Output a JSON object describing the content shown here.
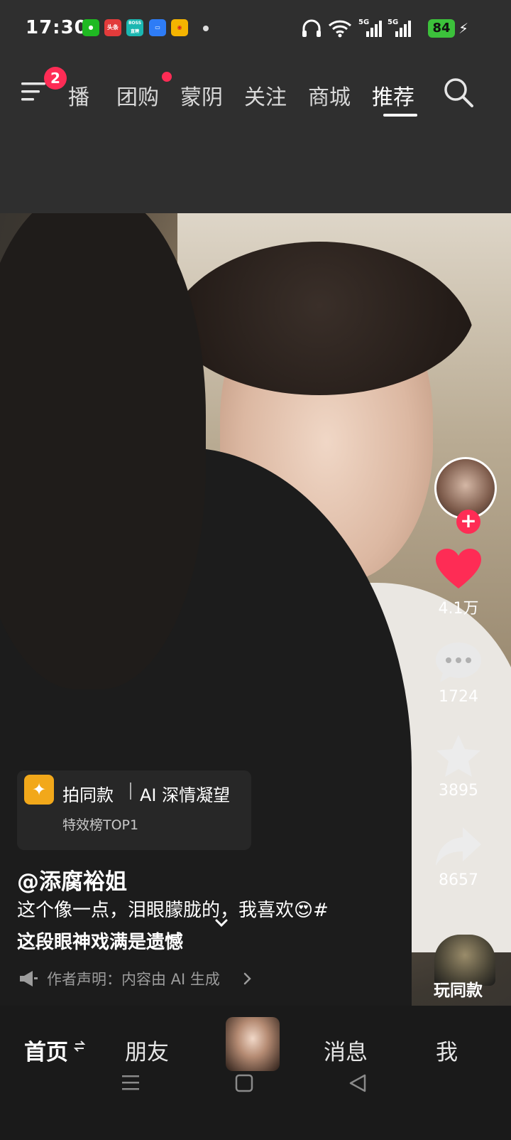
{
  "status_bar": {
    "time": "17:30",
    "notification_icons": [
      {
        "name": "wechat-icon",
        "label": "",
        "color": "#1fb922"
      },
      {
        "name": "toutiao-icon",
        "label": "头条",
        "color": "#e23b3b"
      },
      {
        "name": "boss-icon",
        "label": "BOSS直聘",
        "color": "#1bb7b1"
      },
      {
        "name": "files-icon",
        "label": "",
        "color": "#2e7cf6"
      },
      {
        "name": "weibo-icon",
        "label": "",
        "color": "#f4b400"
      }
    ],
    "network_1": "5G",
    "network_2": "5G",
    "battery": "84"
  },
  "top_nav": {
    "menu_badge": "2",
    "tabs": [
      {
        "label": "播",
        "active": false
      },
      {
        "label": "团购",
        "active": false
      },
      {
        "label": "蒙阴",
        "active": false
      },
      {
        "label": "关注",
        "active": false
      },
      {
        "label": "商城",
        "active": false
      },
      {
        "label": "推荐",
        "active": true
      }
    ]
  },
  "right_rail": {
    "like_count": "4.1万",
    "comment_count": "1724",
    "favorite_count": "3895",
    "share_count": "8657",
    "same_style_label": "玩同款"
  },
  "video_info": {
    "effect_title": "拍同款",
    "effect_name": "AI 深情凝望",
    "effect_sub": "特效榜TOP1",
    "author": "@添腐裕姐",
    "caption_line1": "这个像一点，泪眼朦胧的，我喜欢😍#",
    "caption_line2": "这段眼神戏满是遗憾",
    "declaration": "作者声明：内容由 AI 生成"
  },
  "bottom_nav": {
    "home": "首页",
    "friends": "朋友",
    "messages": "消息",
    "me": "我"
  },
  "colors": {
    "accent": "#fe2c55",
    "battery": "#3cc13b",
    "effect_icon": "#f2a81a"
  }
}
